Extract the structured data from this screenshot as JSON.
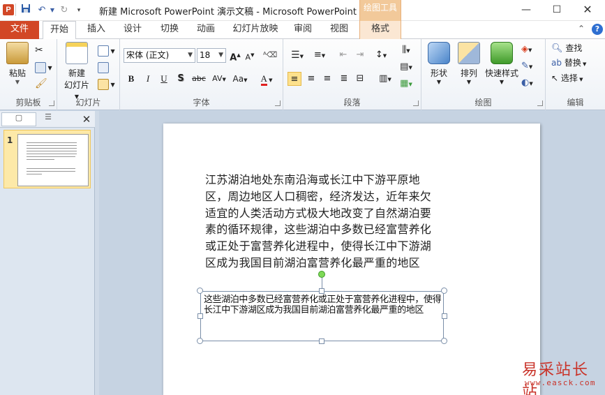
{
  "window": {
    "title": "新建 Microsoft PowerPoint 演示文稿 - Microsoft PowerPoint",
    "contextual_tools": "绘图工具",
    "app_icon_letter": "P"
  },
  "tabs": {
    "file": "文件",
    "items": [
      "开始",
      "插入",
      "设计",
      "切换",
      "动画",
      "幻灯片放映",
      "审阅",
      "视图",
      "格式"
    ],
    "active": "开始"
  },
  "ribbon": {
    "clipboard": {
      "label": "剪贴板",
      "paste": "粘贴"
    },
    "slides": {
      "label": "幻灯片",
      "new_slide_line1": "新建",
      "new_slide_line2": "幻灯片"
    },
    "font": {
      "label": "字体",
      "font_name": "宋体 (正文)",
      "font_size": "18",
      "bold": "B",
      "italic": "I",
      "underline": "U",
      "shadow": "S",
      "strike": "abc",
      "spacing": "AV",
      "case": "Aa",
      "color": "A",
      "grow": "A",
      "shrink": "A"
    },
    "paragraph": {
      "label": "段落"
    },
    "drawing": {
      "label": "绘图",
      "shapes": "形状",
      "arrange": "排列",
      "quick_styles": "快速样式"
    },
    "editing": {
      "label": "编辑",
      "find": "查找",
      "replace": "替换",
      "select": "选择"
    }
  },
  "left_panel": {
    "slide_number": "1"
  },
  "slide": {
    "paragraph1": "江苏湖泊地处东南沿海或长江中下游平原地区，周边地区人口稠密，经济发达，近年来欠适宜的人类活动方式极大地改变了自然湖泊要素的循环规律，这些湖泊中多数已经富营养化或正处于富营养化进程中，使得长江中下游湖区成为我国目前湖泊富营养化最严重的地区",
    "textbox": "这些湖泊中多数已经富营养化或正处于富营养化进程中，使得长江中下游湖区成为我国目前湖泊富营养化最严重的地区"
  },
  "watermark": {
    "name": "易采站长站",
    "url": "www.easck.com"
  }
}
